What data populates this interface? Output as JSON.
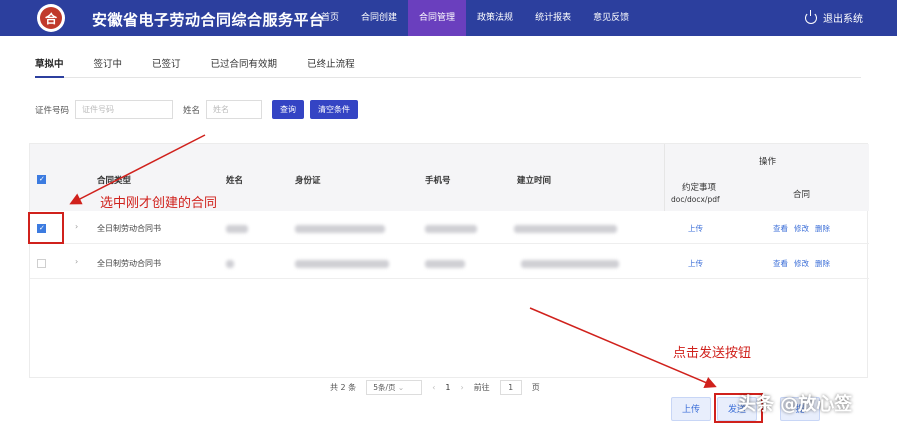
{
  "header": {
    "logo_char": "合",
    "title": "安徽省电子劳动合同综合服务平台",
    "nav": [
      "首页",
      "合同创建",
      "合同管理",
      "政策法规",
      "统计报表",
      "意见反馈"
    ],
    "active_nav": 2,
    "logout": "退出系统"
  },
  "tabs": [
    "草拟中",
    "签订中",
    "已签订",
    "已过合同有效期",
    "已终止流程"
  ],
  "filter": {
    "id_label": "证件号码",
    "id_placeholder": "证件号码",
    "name_label": "姓名",
    "name_placeholder": "姓名",
    "query": "查询",
    "clear": "清空条件"
  },
  "table": {
    "headers": {
      "type": "合同类型",
      "name": "姓名",
      "id": "身份证",
      "phone": "手机号",
      "created": "建立时间",
      "ops": "操作",
      "agreement": "约定事项",
      "agreement_sub": "doc/docx/pdf",
      "contract": "合同"
    },
    "rows": [
      {
        "type": "全日制劳动合同书",
        "upload": "上传",
        "view": "查看",
        "edit": "修改",
        "delete": "删除",
        "checked": true
      },
      {
        "type": "全日制劳动合同书",
        "upload": "上传",
        "view": "查看",
        "edit": "修改",
        "delete": "删除",
        "checked": false
      }
    ]
  },
  "pager": {
    "total": "共 2 条",
    "page_size": "5条/页",
    "current": "1",
    "goto": "前往",
    "goto_value": "1",
    "page_unit": "页"
  },
  "actions": {
    "upload": "上传",
    "send": "发送",
    "other": "提"
  },
  "annotations": {
    "select_hint": "选中刚才创建的合同",
    "send_hint": "点击发送按钮"
  },
  "watermark": "头条 @放心签",
  "colors": {
    "header_bg": "#2c3f9e",
    "active_nav": "#6a3fbe",
    "accent": "#3444c4",
    "annotation": "#d0211c"
  }
}
